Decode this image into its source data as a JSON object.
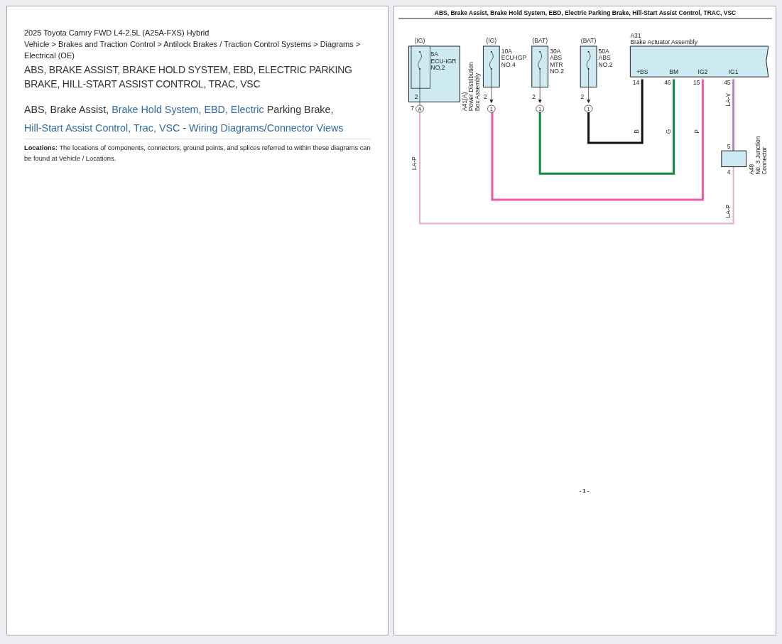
{
  "document": {
    "vehicle": "2025 Toyota Camry FWD L4-2.5L (A25A-FXS) Hybrid",
    "breadcrumb": "Vehicle > Brakes and Traction Control > Antilock Brakes / Traction Control Systems > Diagrams > Electrical (OE)",
    "heading": "ABS, BRAKE ASSIST, BRAKE HOLD SYSTEM, EBD, ELECTRIC PARKING BRAKE, HILL-START ASSIST CONTROL, TRAC, VSC",
    "title_segments": [
      {
        "text": "ABS, Brake Assist, ",
        "link": false
      },
      {
        "text": "Brake Hold System, EBD, Electric",
        "link": true
      },
      {
        "text": " Parking Brake, ",
        "link": false
      },
      {
        "text": "Hill-Start Assist",
        "link": true
      },
      {
        "text": "Control, Trac, VSC",
        "link": true
      },
      {
        "text": " - ",
        "link": false
      },
      {
        "text": "Wiring Diagrams/Connector Views",
        "link": true
      }
    ],
    "note": "**Locations:** The locations of components, connectors, ground points, and splices referred to within these diagrams can be found at Vehicle / Locations."
  },
  "diagram_page": {
    "title": "ABS, Brake Assist, Brake Hold System, EBD, Electric Parking Brake, Hill-Start Assist Control, TRAC, VSC",
    "fuse_box": {
      "supply": "(IG)",
      "rating": [
        "5A",
        "ECU-IGR",
        "NO.2"
      ],
      "pin": "2",
      "connector_pin": "7",
      "connector": "A",
      "label": [
        "A41(A)",
        "Power Distribution",
        "Box Assembly"
      ]
    },
    "fuses": [
      {
        "supply": "(IG)",
        "rating": [
          "10A",
          "ECU-IGP",
          "NO.4"
        ],
        "pin": "2",
        "connector": "1"
      },
      {
        "supply": "(BAT)",
        "rating": [
          "30A",
          "ABS",
          "MTR",
          "NO.2"
        ],
        "pin": "2",
        "connector": "1"
      },
      {
        "supply": "(BAT)",
        "rating": [
          "50A",
          "ABS",
          "NO.2"
        ],
        "pin": "2",
        "connector": "1"
      }
    ],
    "actuator": {
      "code": "A31",
      "name": "Brake Actuator Assembly",
      "terminals": [
        {
          "name": "+BS",
          "pin": "14"
        },
        {
          "name": "BM",
          "pin": "46"
        },
        {
          "name": "IG2",
          "pin": "15"
        },
        {
          "name": "IG1",
          "pin": "45"
        }
      ]
    },
    "junction": {
      "top_pin": "5",
      "bottom_pin": "4",
      "label": [
        "A48",
        "No. 3 Junction",
        "Connector"
      ]
    },
    "wires": [
      {
        "labels": [
          "LA-P",
          "LA-P"
        ],
        "color": "#e9a9cf"
      },
      {
        "labels": [
          "P"
        ],
        "color": "#e95aa3"
      },
      {
        "labels": [
          "G"
        ],
        "color": "#128a3c"
      },
      {
        "labels": [
          "B"
        ],
        "color": "#111111"
      },
      {
        "labels": [
          "LA-V"
        ],
        "color": "#a98bc6"
      }
    ],
    "page_number": "- 1 -"
  }
}
